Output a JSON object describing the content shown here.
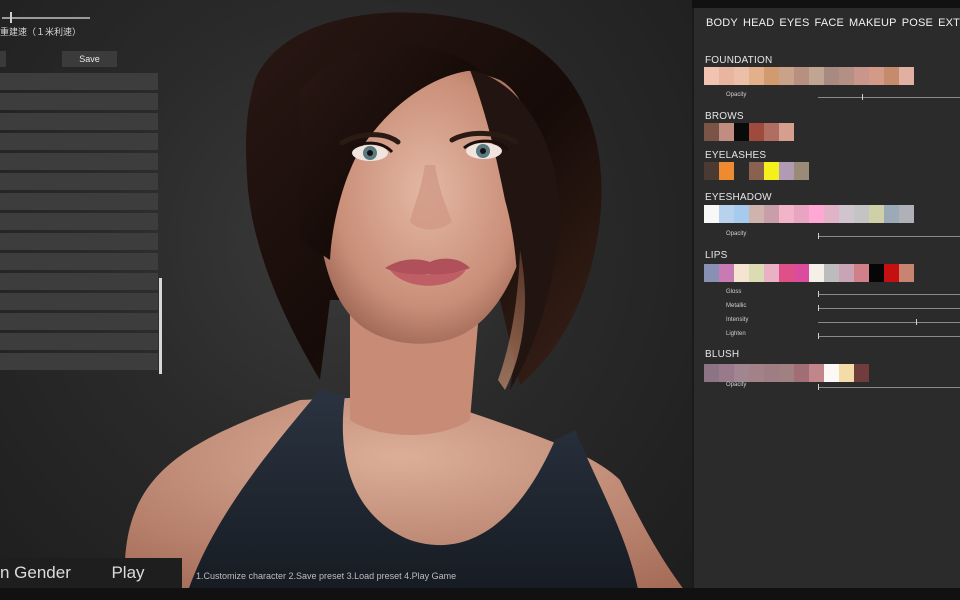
{
  "left_panel": {
    "preset_name": "重建速（１米利速）",
    "save_label": "Save",
    "preset_rows": 15
  },
  "bottom": {
    "gender_label": "n Gender",
    "play_label": "Play",
    "instructions": "1.Customize  character  2.Save preset  3.Load preset  4.Play Game"
  },
  "tabs": [
    "BODY",
    "HEAD",
    "EYES",
    "FACE",
    "MAKEUP",
    "POSE",
    "EXTR"
  ],
  "sections": {
    "foundation": {
      "label": "FOUNDATION",
      "swatches": [
        "#f0c4b0",
        "#e8b59e",
        "#ecc0a8",
        "#e2b18c",
        "#d29a6f",
        "#c9a28a",
        "#b89080",
        "#c0a692",
        "#a88a80",
        "#b39083",
        "#c8968a",
        "#d49a88",
        "#c68a6c",
        "#e2b0a2"
      ],
      "params": [
        {
          "label": "Opacity",
          "value": 0.3
        }
      ]
    },
    "brows": {
      "label": "BROWS",
      "swatches": [
        "#7a5446",
        "#c08d80",
        "#0a0a0a",
        "#9e4a3c",
        "#b06e62",
        "#d69e8e"
      ]
    },
    "eyelashes": {
      "label": "EYELASHES",
      "swatches": [
        "#4a3a32",
        "#ee8a30",
        "#2b2b2b",
        "#8a6050",
        "#f4f01c",
        "#b09ab4",
        "#9a8a78"
      ]
    },
    "eyeshadow": {
      "label": "EYESHADOW",
      "swatches": [
        "#f8f8f8",
        "#b8d2ee",
        "#a6cbee",
        "#cfb4ae",
        "#c89eaa",
        "#f2b4c8",
        "#e8a4c0",
        "#ffa8d6",
        "#e0b4c6",
        "#d0c4ce",
        "#c4c4c4",
        "#d0d0a8",
        "#9aaab6",
        "#b0b0b8"
      ],
      "params": [
        {
          "label": "Opacity",
          "value": 0.0
        }
      ]
    },
    "lips": {
      "label": "LIPS",
      "swatches": [
        "#8890b4",
        "#c87ab2",
        "#f4e4d0",
        "#dcdcb4",
        "#eab0c4",
        "#e05088",
        "#dc4c9e",
        "#f4f0e8",
        "#bcbcbc",
        "#c8a4b4",
        "#d08088",
        "#060606",
        "#c41010",
        "#c88470"
      ],
      "params": [
        {
          "label": "Gloss",
          "value": 0.0
        },
        {
          "label": "Metallic",
          "value": 0.0
        },
        {
          "label": "Intensity",
          "value": 0.66
        },
        {
          "label": "Lighten",
          "value": 0.0
        }
      ]
    },
    "blush": {
      "label": "BLUSH",
      "swatches": [
        "#8c7484",
        "#987a8a",
        "#a08690",
        "#a28288",
        "#9e7e84",
        "#a08080",
        "#a26e76",
        "#c0868a",
        "#fcf8f6",
        "#f4dca8",
        "#703c3c"
      ],
      "params": [
        {
          "label": "Opacity",
          "value": 0.0
        }
      ]
    }
  }
}
